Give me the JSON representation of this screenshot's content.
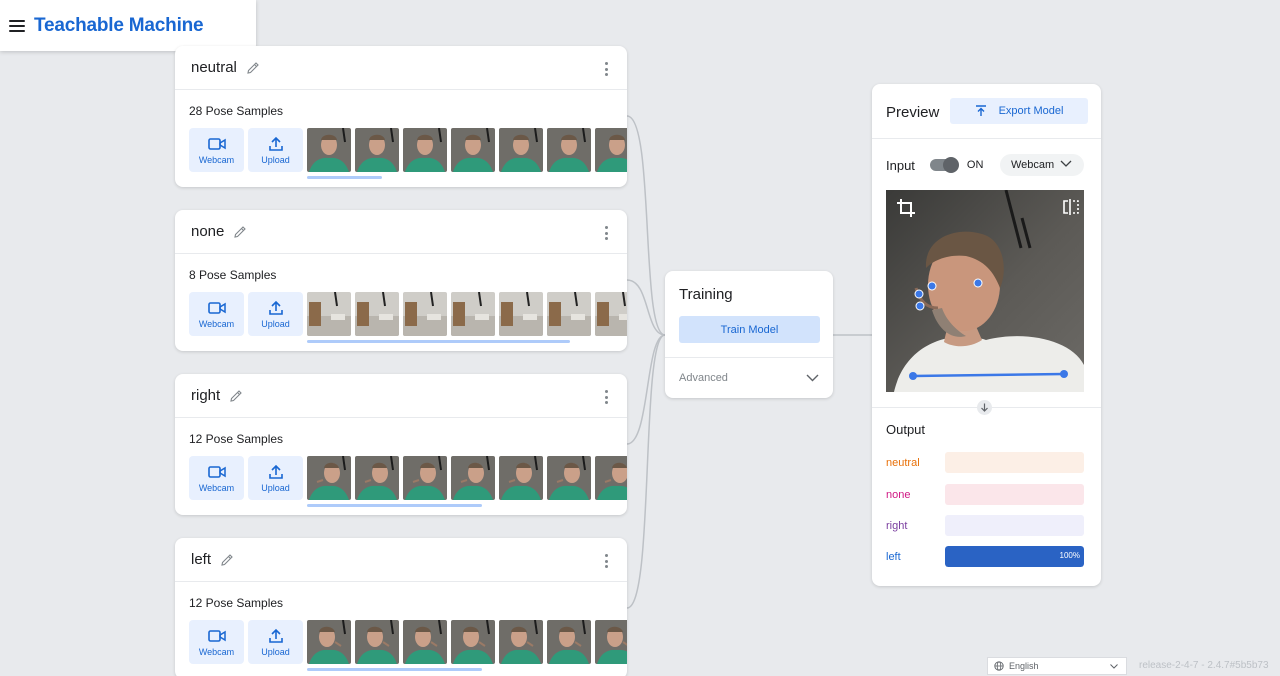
{
  "app": {
    "title": "Teachable Machine"
  },
  "classes": [
    {
      "name": "neutral",
      "sample_count": "28 Pose Samples",
      "variant": "neutral",
      "scroll_fraction": 0.24
    },
    {
      "name": "none",
      "sample_count": "8 Pose Samples",
      "variant": "none",
      "scroll_fraction": 0.84
    },
    {
      "name": "right",
      "sample_count": "12 Pose Samples",
      "variant": "right",
      "scroll_fraction": 0.56
    },
    {
      "name": "left",
      "sample_count": "12 Pose Samples",
      "variant": "left",
      "scroll_fraction": 0.56
    }
  ],
  "sample_buttons": {
    "webcam": "Webcam",
    "upload": "Upload"
  },
  "training": {
    "title": "Training",
    "train_button": "Train Model",
    "advanced": "Advanced"
  },
  "preview": {
    "title": "Preview",
    "export_button": "Export Model",
    "input_label": "Input",
    "toggle_state": "ON",
    "source": "Webcam",
    "output_title": "Output",
    "outputs": [
      {
        "label": "neutral",
        "color": "#e8710a",
        "track": "#fcefe6",
        "fill": "#e8710a",
        "value": 0,
        "pct": ""
      },
      {
        "label": "none",
        "color": "#d01884",
        "track": "#fbe6ea",
        "fill": "#d01884",
        "value": 0,
        "pct": ""
      },
      {
        "label": "right",
        "color": "#7b3fa0",
        "track": "#efeffb",
        "fill": "#7b3fa0",
        "value": 0,
        "pct": ""
      },
      {
        "label": "left",
        "color": "#1967d2",
        "track": "#e8f0fe",
        "fill": "#2a63c4",
        "value": 1.0,
        "pct": "100%"
      }
    ]
  },
  "footer": {
    "language": "English",
    "release": "release-2-4-7 - 2.4.7#5b5b73"
  },
  "colors": {
    "accent": "#1967d2",
    "card_bg": "#ffffff",
    "page_bg": "#e8eaed"
  },
  "icons": [
    "menu-icon",
    "pencil-icon",
    "more-vert-icon",
    "videocam-icon",
    "upload-icon",
    "chevron-down-icon",
    "export-icon",
    "crop-icon",
    "flip-icon",
    "arrow-down-icon",
    "globe-icon"
  ]
}
